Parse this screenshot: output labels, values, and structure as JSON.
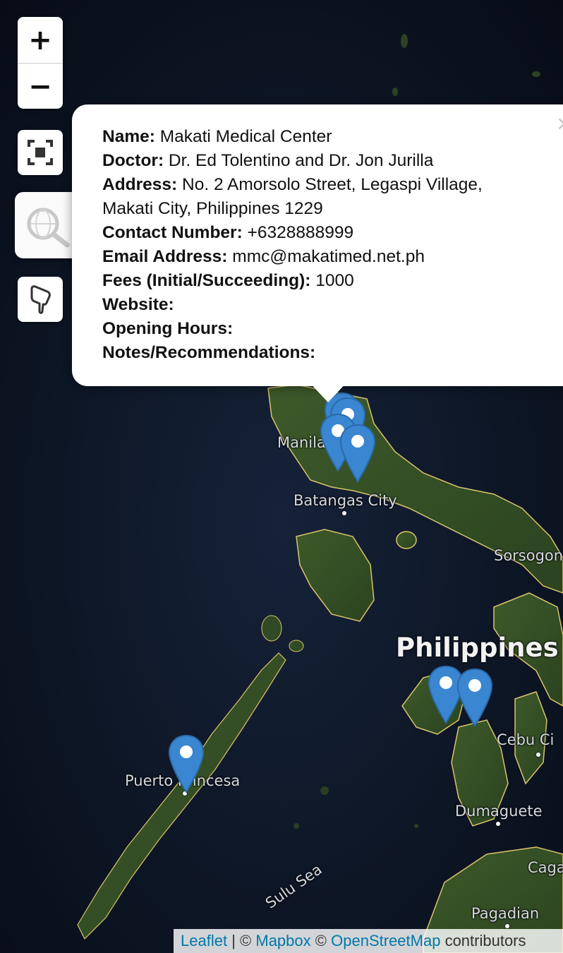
{
  "controls": {
    "zoom_in": "+",
    "zoom_out": "−"
  },
  "popup": {
    "close": "×",
    "fields": [
      {
        "label": "Name:",
        "value": "Makati Medical Center"
      },
      {
        "label": "Doctor:",
        "value": "Dr. Ed Tolentino and Dr. Jon Jurilla"
      },
      {
        "label": "Address:",
        "value": "No. 2 Amorsolo Street, Legaspi Village,"
      },
      {
        "label": "",
        "value": "Makati City, Philippines 1229"
      },
      {
        "label": "Contact Number:",
        "value": "+6328888999"
      },
      {
        "label": "Email Address:",
        "value": "mmc@makatimed.net.ph"
      },
      {
        "label": "Fees (Initial/Succeeding):",
        "value": "1000"
      },
      {
        "label": "Website:",
        "value": ""
      },
      {
        "label": "Opening Hours:",
        "value": ""
      },
      {
        "label": "Notes/Recommendations:",
        "value": ""
      }
    ]
  },
  "map_labels": {
    "country": "Philippines",
    "manila": "Manila",
    "batangas": "Batangas City",
    "sorsogon": "Sorsogon",
    "cebu": "Cebu Ci",
    "puerto_princesa": "Puerto Princesa",
    "dumaguete": "Dumaguete",
    "pagadian": "Pagadian",
    "cagayan": "Caga",
    "sulu_sea": "Sulu Sea"
  },
  "attribution": {
    "leaflet": "Leaflet",
    "sep": "|",
    "copy1": "©",
    "mapbox": "Mapbox",
    "copy2": "©",
    "osm": "OpenStreetMap",
    "suffix": "contributors"
  },
  "colors": {
    "marker": "#3a86d1",
    "land": "#2f4a24",
    "sea": "#0b1322",
    "border": "#d9c46a",
    "link": "#0078a8"
  }
}
